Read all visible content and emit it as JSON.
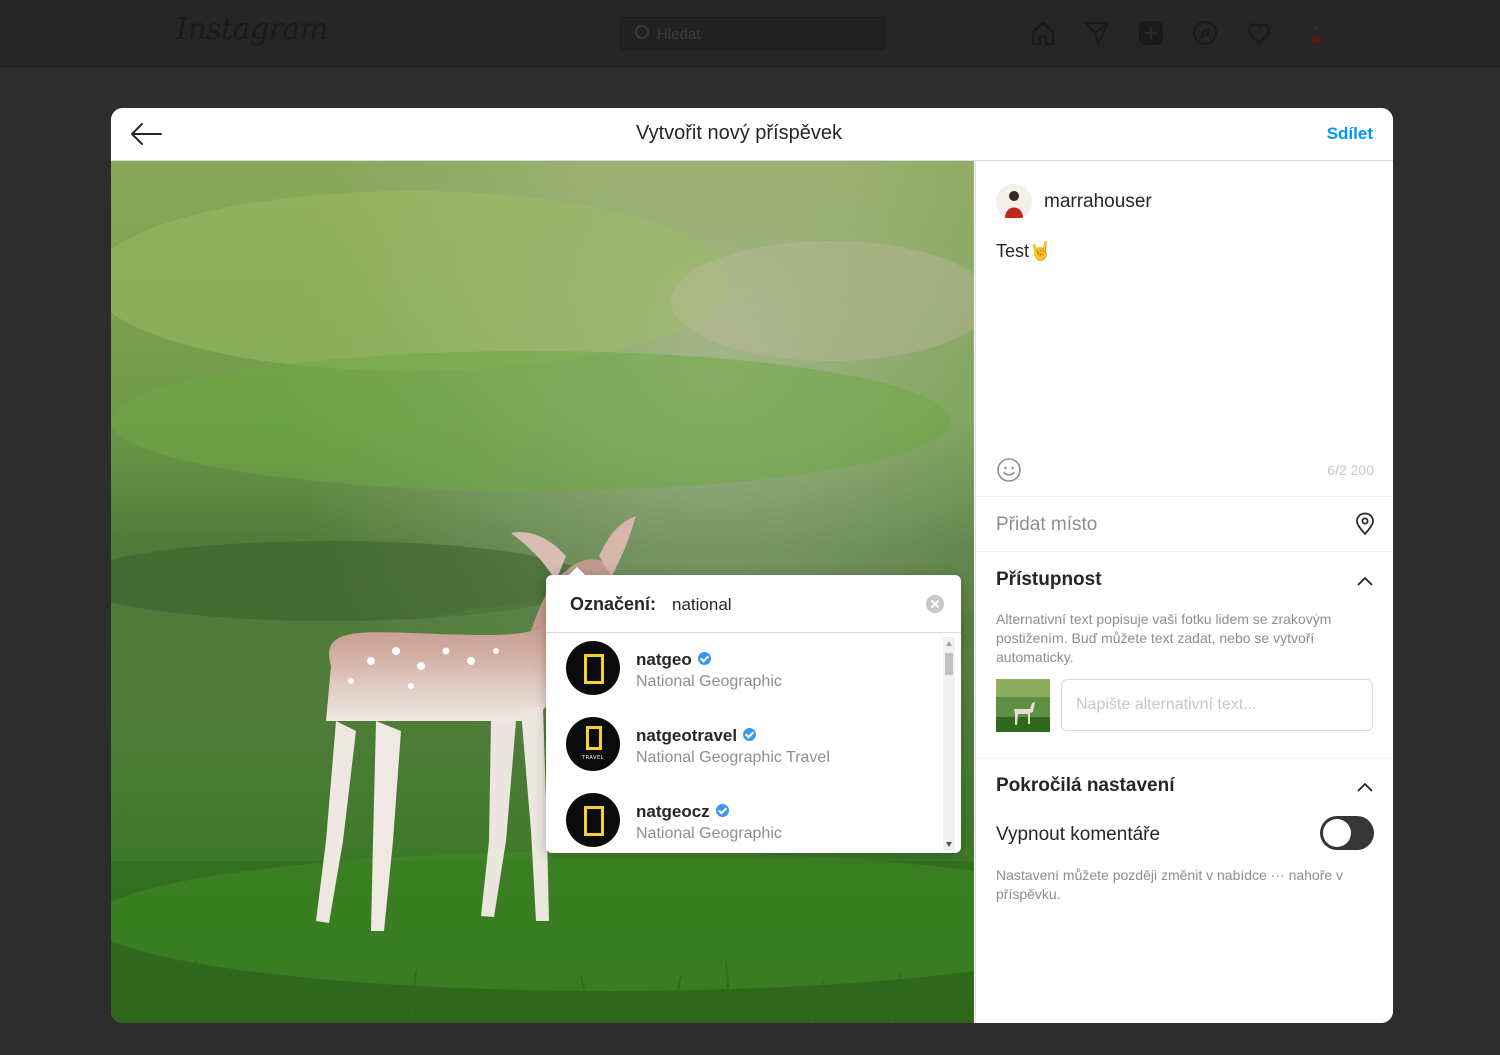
{
  "topnav": {
    "logo": "Instagram",
    "search_placeholder": "Hledat"
  },
  "modal": {
    "title": "Vytvořit nový příspěvek",
    "share_label": "Sdílet"
  },
  "post": {
    "username": "marrahouser",
    "caption": "Test🤘",
    "char_count": "6/2 200",
    "location_placeholder": "Přidat místo"
  },
  "accessibility": {
    "title": "Přístupnost",
    "description": "Alternativní text popisuje vaši fotku lidem se zrakovým postižením. Buď můžete text zadat, nebo se vytvoří automaticky.",
    "alt_placeholder": "Napište alternativní text..."
  },
  "advanced": {
    "title": "Pokročilá nastavení",
    "comments_off_label": "Vypnout komentáře",
    "comments_off": false,
    "note": "Nastavení můžete později změnit v nabídce ··· nahoře v příspěvku."
  },
  "tag_popup": {
    "label": "Označení:",
    "query": "national",
    "results": [
      {
        "username": "natgeo",
        "full_name": "National Geographic",
        "verified": true
      },
      {
        "username": "natgeotravel",
        "full_name": "National Geographic Travel",
        "verified": true,
        "badge_text": "TRAVEL"
      },
      {
        "username": "natgeocz",
        "full_name": "National Geographic",
        "verified": true
      }
    ]
  },
  "colors": {
    "accent": "#0095f6",
    "verified": "#3897f0",
    "natgeo_yellow": "#f5d32a"
  }
}
